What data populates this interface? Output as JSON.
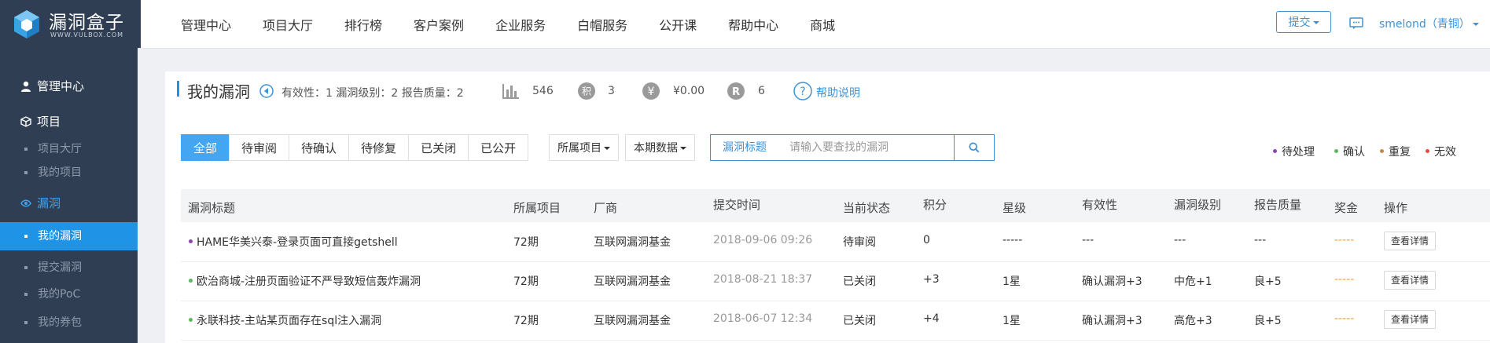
{
  "brand": {
    "name": "漏洞盒子",
    "sub": "WWW.VULBOX.COM"
  },
  "nav": [
    "管理中心",
    "项目大厅",
    "排行榜",
    "客户案例",
    "企业服务",
    "白帽服务",
    "公开课",
    "帮助中心",
    "商城"
  ],
  "header": {
    "submit_label": "提交",
    "user": "smelond（青铜）"
  },
  "sidebar": {
    "groups": [
      {
        "label": "管理中心",
        "icon": "user-icon"
      },
      {
        "label": "项目",
        "icon": "cube-icon",
        "items": [
          "项目大厅",
          "我的项目"
        ]
      },
      {
        "label": "漏洞",
        "icon": "eye-icon",
        "items": [
          "我的漏洞",
          "提交漏洞",
          "我的PoC",
          "我的券包"
        ]
      }
    ],
    "active_item": "我的漏洞"
  },
  "page": {
    "title": "我的漏洞",
    "summary": "有效性：1 漏洞级别：2 报告质量：2",
    "stats": [
      {
        "icon": "bar-chart-icon",
        "value": "546"
      },
      {
        "icon": "points-badge-icon",
        "label": "积",
        "value": "3"
      },
      {
        "icon": "yen-icon",
        "label": "¥",
        "value": "¥0.00"
      },
      {
        "icon": "r-badge-icon",
        "label": "R",
        "value": "6"
      }
    ],
    "help": "帮助说明"
  },
  "filters": {
    "tabs": [
      "全部",
      "待审阅",
      "待确认",
      "待修复",
      "已关闭",
      "已公开"
    ],
    "active_tab": "全部",
    "project_dropdown": "所属项目",
    "period_dropdown": "本期数据",
    "search_label": "漏洞标题",
    "search_placeholder": "请输入要查找的漏洞"
  },
  "legend": [
    {
      "label": "待处理",
      "color": "#8e44ad"
    },
    {
      "label": "确认",
      "color": "#5cb85c"
    },
    {
      "label": "重复",
      "color": "#c0874e"
    },
    {
      "label": "无效",
      "color": "#e74c3c"
    }
  ],
  "table": {
    "columns": [
      "漏洞标题",
      "所属项目",
      "厂商",
      "提交时间",
      "当前状态",
      "积分",
      "星级",
      "有效性",
      "漏洞级别",
      "报告质量",
      "奖金",
      "操作"
    ],
    "rows": [
      {
        "dot_color": "#8e44ad",
        "title": "HAME华美兴泰-登录页面可直接getshell",
        "project": "72期",
        "vendor": "互联网漏洞基金",
        "time": "2018-09-06 09:26",
        "status": "待审阅",
        "points": "0",
        "stars": "-----",
        "validity": "---",
        "level": "---",
        "quality": "---",
        "bonus": "-----",
        "action": "查看详情"
      },
      {
        "dot_color": "#5cb85c",
        "title": "欧治商城-注册页面验证不严导致短信轰炸漏洞",
        "project": "72期",
        "vendor": "互联网漏洞基金",
        "time": "2018-08-21 18:37",
        "status": "已关闭",
        "points": "+3",
        "stars": "1星",
        "validity": "确认漏洞+3",
        "level": "中危+1",
        "quality": "良+5",
        "bonus": "-----",
        "action": "查看详情"
      },
      {
        "dot_color": "#5cb85c",
        "title": "永联科技-主站某页面存在sql注入漏洞",
        "project": "72期",
        "vendor": "互联网漏洞基金",
        "time": "2018-06-07 12:34",
        "status": "已关闭",
        "points": "+4",
        "stars": "1星",
        "validity": "确认漏洞+3",
        "level": "高危+3",
        "quality": "良+5",
        "bonus": "-----",
        "action": "查看详情"
      }
    ]
  }
}
